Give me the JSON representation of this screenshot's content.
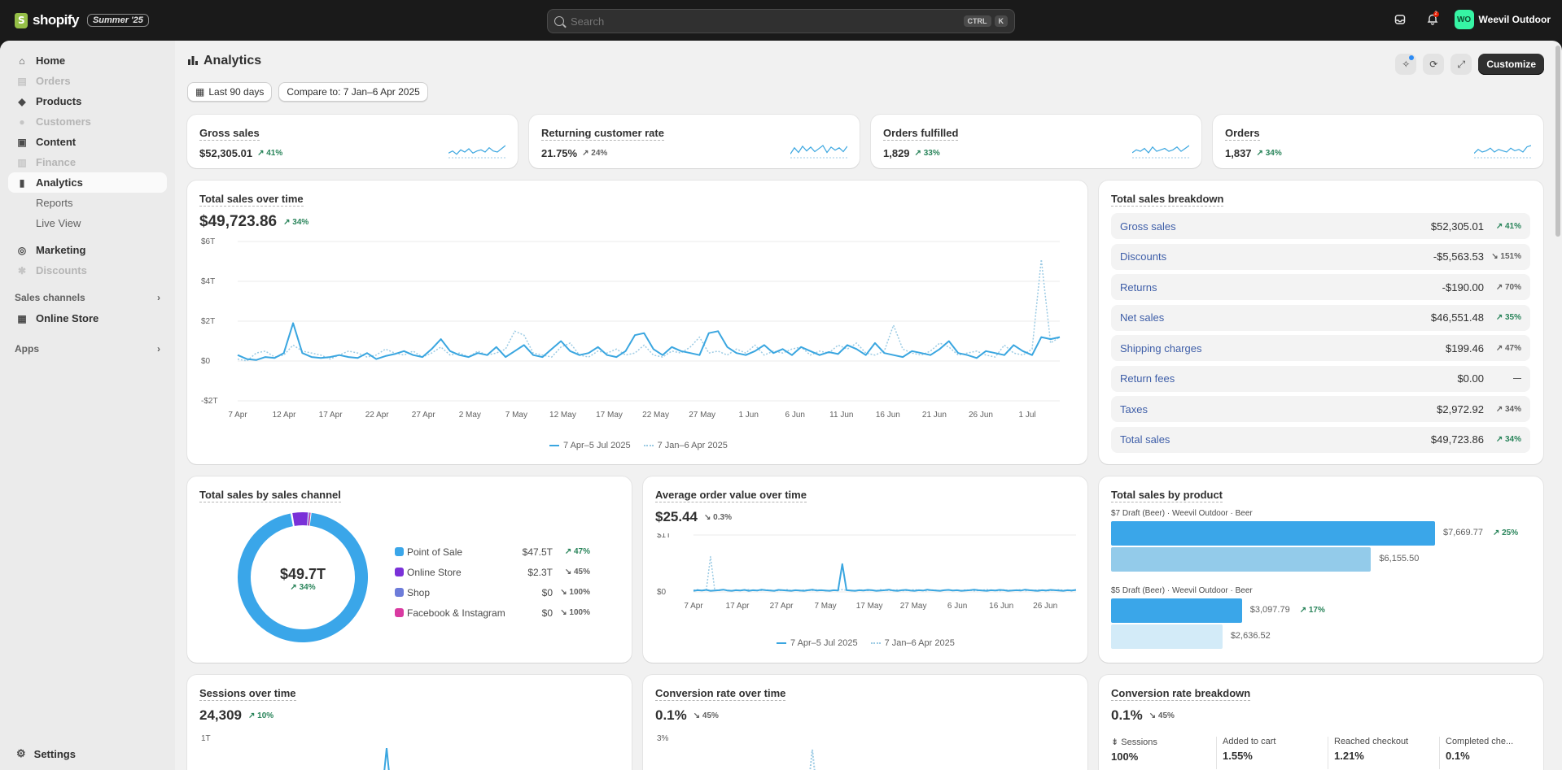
{
  "topbar": {
    "brand": "shopify",
    "edition_badge": "Summer '25",
    "search_placeholder": "Search",
    "shortcut_keys": [
      "CTRL",
      "K"
    ],
    "notification_count": "2",
    "store_initials": "WO",
    "store_name": "Weevil Outdoor"
  },
  "sidebar": {
    "items": [
      {
        "label": "Home",
        "icon": "home-icon",
        "disabled": false
      },
      {
        "label": "Orders",
        "icon": "orders-icon",
        "disabled": true
      },
      {
        "label": "Products",
        "icon": "tag-icon",
        "disabled": false
      },
      {
        "label": "Customers",
        "icon": "person-icon",
        "disabled": true
      },
      {
        "label": "Content",
        "icon": "content-icon",
        "disabled": false
      },
      {
        "label": "Finance",
        "icon": "bank-icon",
        "disabled": true
      },
      {
        "label": "Analytics",
        "icon": "chart-icon",
        "disabled": false,
        "active": true
      }
    ],
    "sub_items": [
      "Reports",
      "Live View"
    ],
    "items2": [
      {
        "label": "Marketing",
        "icon": "target-icon",
        "disabled": false
      },
      {
        "label": "Discounts",
        "icon": "discount-icon",
        "disabled": true
      }
    ],
    "sales_channels_label": "Sales channels",
    "online_store_label": "Online Store",
    "apps_label": "Apps",
    "settings_label": "Settings"
  },
  "page": {
    "title": "Analytics",
    "customize_label": "Customize",
    "date_filter": "Last 90 days",
    "compare_filter": "Compare to: 7 Jan–6 Apr 2025"
  },
  "kpis": [
    {
      "title": "Gross sales",
      "value": "$52,305.01",
      "delta": "41%",
      "trend": "up"
    },
    {
      "title": "Returning customer rate",
      "value": "21.75%",
      "delta": "24%",
      "trend": "neutral"
    },
    {
      "title": "Orders fulfilled",
      "value": "1,829",
      "delta": "33%",
      "trend": "up"
    },
    {
      "title": "Orders",
      "value": "1,837",
      "delta": "34%",
      "trend": "up"
    }
  ],
  "total_sales": {
    "title": "Total sales over time",
    "value": "$49,723.86",
    "delta": "34%",
    "legend_current": "7 Apr–5 Jul 2025",
    "legend_previous": "7 Jan–6 Apr 2025"
  },
  "breakdown": {
    "title": "Total sales breakdown",
    "rows": [
      {
        "label": "Gross sales",
        "value": "$52,305.01",
        "delta": "41%",
        "trend": "up"
      },
      {
        "label": "Discounts",
        "value": "-$5,563.53",
        "delta": "151%",
        "trend": "down"
      },
      {
        "label": "Returns",
        "value": "-$190.00",
        "delta": "70%",
        "trend": "neutral"
      },
      {
        "label": "Net sales",
        "value": "$46,551.48",
        "delta": "35%",
        "trend": "up"
      },
      {
        "label": "Shipping charges",
        "value": "$199.46",
        "delta": "47%",
        "trend": "neutral"
      },
      {
        "label": "Return fees",
        "value": "$0.00",
        "delta": "—",
        "trend": "none"
      },
      {
        "label": "Taxes",
        "value": "$2,972.92",
        "delta": "34%",
        "trend": "neutral"
      },
      {
        "label": "Total sales",
        "value": "$49,723.86",
        "delta": "34%",
        "trend": "up"
      }
    ]
  },
  "channel": {
    "title": "Total sales by sales channel",
    "center_value": "$49.7T",
    "center_delta": "34%",
    "items": [
      {
        "name": "Point of Sale",
        "value": "$47.5T",
        "delta": "47%",
        "trend": "up",
        "color": "#3aa6e9",
        "share": 0.953
      },
      {
        "name": "Online Store",
        "value": "$2.3T",
        "delta": "45%",
        "trend": "down",
        "color": "#7a31d8",
        "share": 0.043
      },
      {
        "name": "Shop",
        "value": "$0",
        "delta": "100%",
        "trend": "down",
        "color": "#6d7cd9",
        "share": 0.002
      },
      {
        "name": "Facebook & Instagram",
        "value": "$0",
        "delta": "100%",
        "trend": "down",
        "color": "#d93aa1",
        "share": 0.002
      }
    ]
  },
  "aov": {
    "title": "Average order value over time",
    "value": "$25.44",
    "delta": "0.3%",
    "legend_current": "7 Apr–5 Jul 2025",
    "legend_previous": "7 Jan–6 Apr 2025"
  },
  "products": {
    "title": "Total sales by product",
    "items": [
      {
        "label": "$7 Draft (Beer) · Weevil Outdoor · Beer",
        "current": "$7,669.77",
        "previous": "$6,155.50",
        "delta": "25%",
        "current_num": 7669.77,
        "previous_num": 6155.5
      },
      {
        "label": "$5 Draft (Beer) · Weevil Outdoor · Beer",
        "current": "$3,097.79",
        "previous": "$2,636.52",
        "delta": "17%",
        "current_num": 3097.79,
        "previous_num": 2636.52
      }
    ]
  },
  "sessions": {
    "title": "Sessions over time",
    "value": "24,309",
    "delta": "10%",
    "y_top": "1T"
  },
  "conversion": {
    "title": "Conversion rate over time",
    "value": "0.1%",
    "delta": "45%",
    "y_top": "3%"
  },
  "cr_breakdown": {
    "title": "Conversion rate breakdown",
    "value": "0.1%",
    "delta": "45%",
    "steps": [
      {
        "label": "Sessions",
        "value": "100%"
      },
      {
        "label": "Added to cart",
        "value": "1.55%"
      },
      {
        "label": "Reached checkout",
        "value": "1.21%"
      },
      {
        "label": "Completed che...",
        "value": "0.1%"
      }
    ]
  },
  "chart_data": [
    {
      "type": "line",
      "title": "Total sales over time",
      "x_ticks": [
        "7 Apr",
        "12 Apr",
        "17 Apr",
        "22 Apr",
        "27 Apr",
        "2 May",
        "7 May",
        "12 May",
        "17 May",
        "22 May",
        "27 May",
        "1 Jun",
        "6 Jun",
        "11 Jun",
        "16 Jun",
        "21 Jun",
        "26 Jun",
        "1 Jul"
      ],
      "y_ticks": [
        "$6T",
        "$4T",
        "$2T",
        "$0",
        "-$2T"
      ],
      "ylim": [
        -2000,
        6000
      ],
      "series": [
        {
          "name": "7 Apr–5 Jul 2025",
          "style": "solid",
          "color": "#3aa6e0",
          "values": [
            300,
            100,
            50,
            200,
            150,
            400,
            1900,
            400,
            200,
            150,
            200,
            300,
            200,
            150,
            400,
            100,
            250,
            350,
            500,
            300,
            200,
            600,
            1100,
            500,
            300,
            200,
            400,
            300,
            700,
            200,
            500,
            800,
            300,
            200,
            600,
            1000,
            500,
            300,
            400,
            700,
            300,
            200,
            500,
            1300,
            1400,
            600,
            300,
            700,
            500,
            400,
            300,
            1400,
            1500,
            700,
            400,
            300,
            500,
            800,
            400,
            600,
            300,
            700,
            500,
            300,
            450,
            350,
            800,
            600,
            300,
            900,
            400,
            300,
            200,
            500,
            400,
            300,
            600,
            1000,
            400,
            300,
            150,
            500,
            400,
            300,
            800,
            500,
            300,
            1200,
            1100,
            1200
          ]
        },
        {
          "name": "7 Jan–6 Apr 2025",
          "style": "dotted",
          "color": "#9ccbe4",
          "values": [
            100,
            0,
            400,
            500,
            200,
            300,
            800,
            500,
            400,
            300,
            100,
            300,
            500,
            400,
            200,
            300,
            600,
            400,
            300,
            500,
            200,
            400,
            700,
            300,
            400,
            200,
            500,
            300,
            400,
            600,
            1500,
            1300,
            400,
            300,
            200,
            700,
            900,
            300,
            200,
            500,
            400,
            600,
            300,
            400,
            800,
            300,
            200,
            500,
            400,
            700,
            1200,
            400,
            500,
            300,
            600,
            400,
            800,
            300,
            500,
            400,
            600,
            700,
            300,
            500,
            400,
            800,
            600,
            900,
            400,
            300,
            500,
            1800,
            600,
            400,
            300,
            500,
            900,
            700,
            300,
            400,
            500,
            300,
            200,
            800,
            400,
            300,
            600,
            5100,
            900,
            1200
          ]
        }
      ]
    },
    {
      "type": "pie",
      "title": "Total sales by sales channel",
      "categories": [
        "Point of Sale",
        "Online Store",
        "Shop",
        "Facebook & Instagram"
      ],
      "values": [
        47.5,
        2.3,
        0.1,
        0.1
      ]
    },
    {
      "type": "line",
      "title": "Average order value over time",
      "x_ticks": [
        "7 Apr",
        "17 Apr",
        "27 Apr",
        "7 May",
        "17 May",
        "27 May",
        "6 Jun",
        "16 Jun",
        "26 Jun"
      ],
      "y_ticks": [
        "$1T",
        "$0"
      ],
      "ylim": [
        0,
        1000
      ],
      "series": [
        {
          "name": "7 Apr–5 Jul 2025",
          "style": "solid",
          "color": "#3aa6e0",
          "values": [
            20,
            30,
            25,
            35,
            20,
            25,
            30,
            40,
            25,
            20,
            30,
            25,
            35,
            20,
            30,
            25,
            40,
            30,
            25,
            20,
            35,
            30,
            25,
            20,
            30,
            25,
            20,
            30,
            40,
            25,
            30,
            25,
            20,
            30,
            25,
            490,
            30,
            25,
            20,
            30,
            25,
            35,
            30,
            20,
            25,
            30,
            40,
            25,
            20,
            30,
            35,
            25,
            20,
            30,
            25,
            40,
            30,
            25,
            20,
            30,
            35,
            25,
            30,
            20,
            25,
            30,
            40,
            30,
            25,
            20,
            30,
            25,
            35,
            30,
            20,
            25,
            30,
            25,
            40,
            30,
            25,
            20,
            30,
            25,
            35,
            30,
            25,
            20,
            30,
            25,
            35
          ]
        },
        {
          "name": "7 Jan–6 Apr 2025",
          "style": "dotted",
          "color": "#9ccbe4",
          "values": [
            30,
            40,
            20,
            30,
            620,
            30,
            25,
            40,
            30,
            20,
            35,
            25,
            30,
            40,
            20,
            30,
            25,
            35,
            30,
            20,
            25,
            30,
            40,
            25,
            30,
            20,
            35,
            30,
            25,
            40,
            30,
            20,
            25,
            30,
            35,
            40,
            30,
            20,
            25,
            30,
            35,
            25,
            30,
            20,
            40,
            30,
            25,
            30,
            35,
            20,
            25,
            30,
            40,
            30,
            25,
            20,
            35,
            30,
            25,
            30,
            40,
            20,
            30,
            25,
            35,
            30,
            20,
            25,
            30,
            40,
            30,
            25,
            20,
            35,
            30,
            25,
            30,
            40,
            20,
            30,
            25,
            35,
            30,
            20,
            25,
            30,
            40,
            30,
            25,
            20,
            30
          ]
        }
      ]
    },
    {
      "type": "bar",
      "title": "Total sales by product",
      "categories": [
        "$7 Draft (Beer) · Weevil Outdoor · Beer",
        "$5 Draft (Beer) · Weevil Outdoor · Beer"
      ],
      "series": [
        {
          "name": "7 Apr–5 Jul 2025",
          "values": [
            7669.77,
            3097.79
          ]
        },
        {
          "name": "7 Jan–6 Apr 2025",
          "values": [
            6155.5,
            2636.52
          ]
        }
      ]
    }
  ]
}
